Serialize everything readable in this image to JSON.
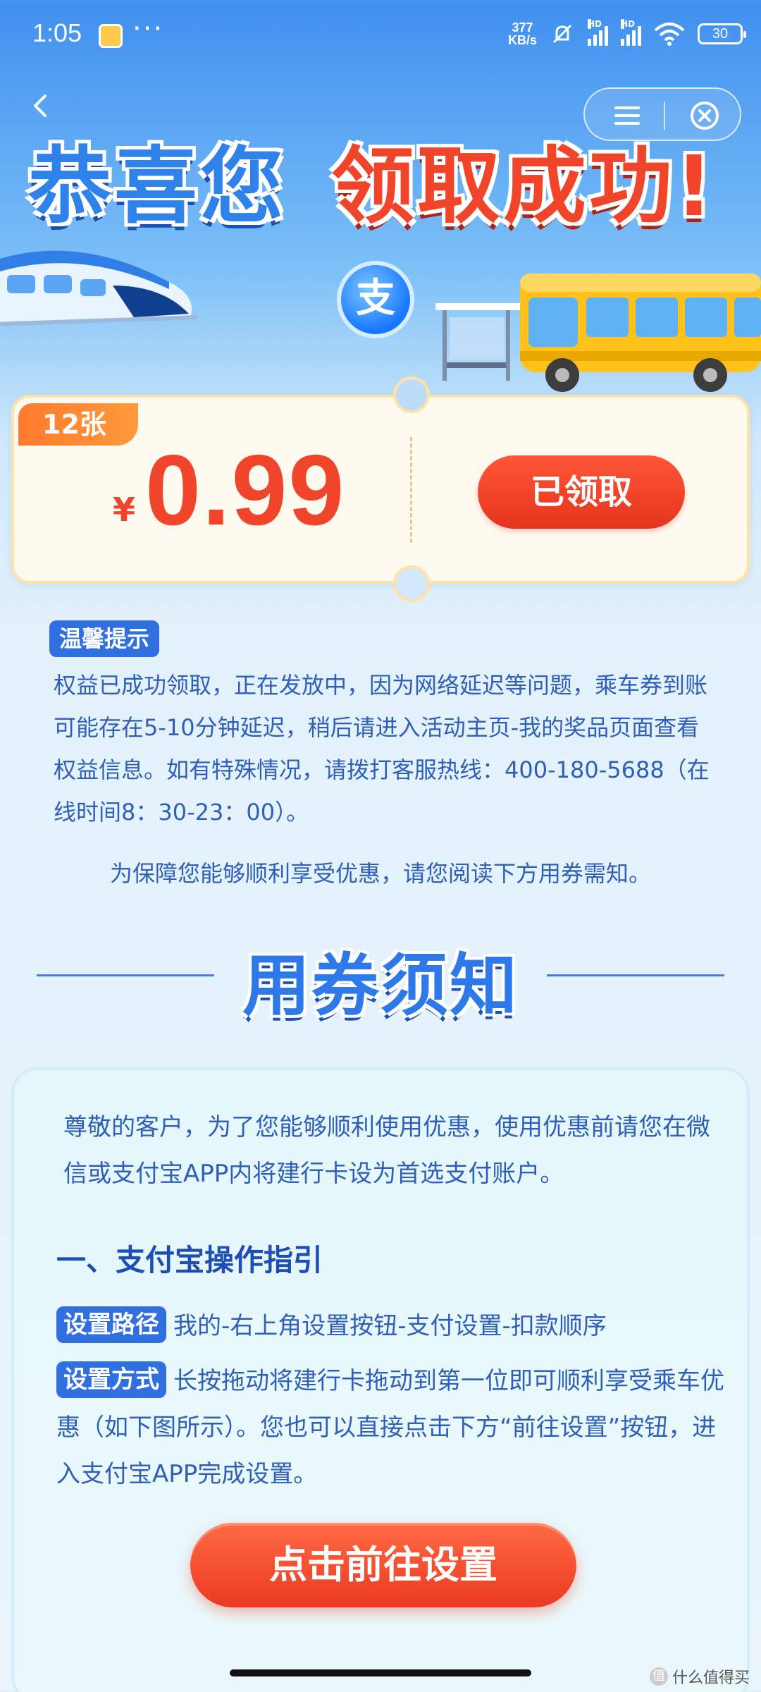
{
  "status_bar": {
    "time": "1:05",
    "more": "···",
    "net_speed_value": "377",
    "net_speed_unit": "KB/s",
    "hd_label": "HD",
    "battery": "30"
  },
  "header": {
    "headline_part1": "恭喜您",
    "headline_part2": "领取成功!",
    "alipay_glyph": "支"
  },
  "ticket": {
    "count": "12张",
    "currency": "¥",
    "price": "0.99",
    "status_button": "已领取"
  },
  "reminder": {
    "tag": "温馨提示",
    "body": "权益已成功领取，正在发放中，因为网络延迟等问题，乘车券到账可能存在5-10分钟延迟，稍后请进入活动主页-我的奖品页面查看权益信息。如有特殊情况，请拨打客服热线：400-180-5688（在线时间8：30-23：00）。",
    "note": "为保障您能够顺利享受优惠，请您阅读下方用券需知。"
  },
  "section": {
    "title": "用券须知"
  },
  "guide": {
    "intro": "尊敬的客户，为了您能够顺利使用优惠，使用优惠前请您在微信或支付宝APP内将建行卡设为首选支付账户。",
    "heading": "一、支付宝操作指引",
    "path_tag": "设置路径",
    "path_text": "我的-右上角设置按钮-支付设置-扣款顺序",
    "method_tag": "设置方式",
    "method_text": "长按拖动将建行卡拖动到第一位即可顺利享受乘车优惠（如下图所示）。您也可以直接点击下方“前往设置”按钮，进入支付宝APP完成设置。",
    "button": "点击前往设置"
  },
  "watermark": {
    "logo": "值",
    "text": "什么值得买"
  },
  "colors": {
    "primary_blue": "#2f6fe0",
    "accent_red": "#f0452a",
    "text_blue": "#2f5fb8"
  }
}
